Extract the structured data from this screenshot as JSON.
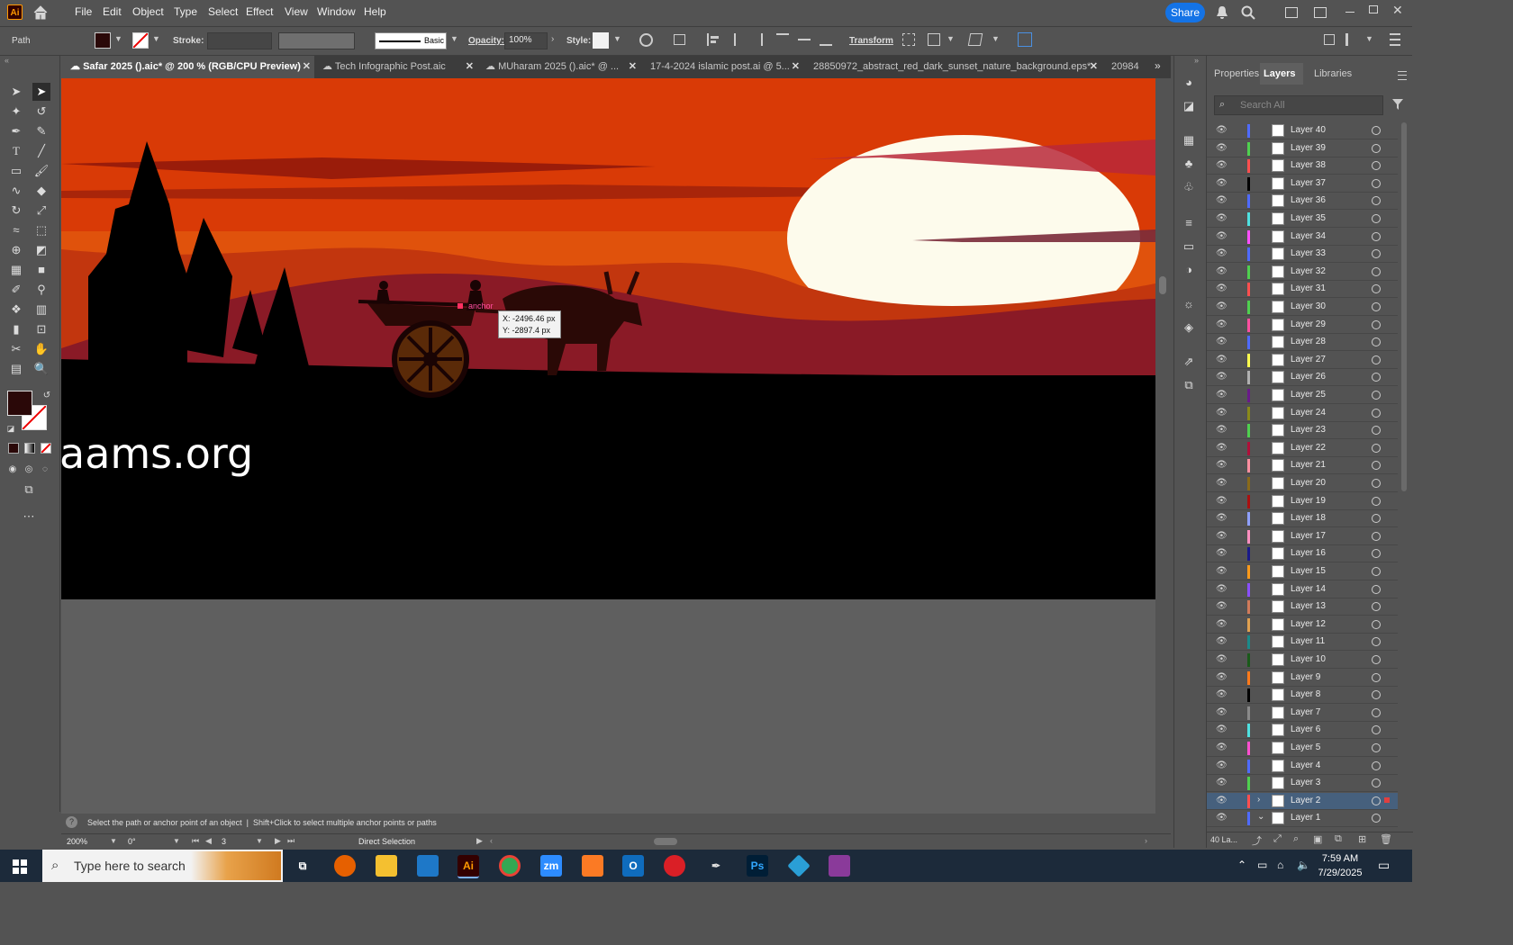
{
  "app": {
    "logo": "Ai",
    "home_icon": "home-icon"
  },
  "menu": [
    "File",
    "Edit",
    "Object",
    "Type",
    "Select",
    "Effect",
    "View",
    "Window",
    "Help"
  ],
  "header_right": {
    "share_label": "Share"
  },
  "control_bar": {
    "selection_type": "Path",
    "stroke_label": "Stroke:",
    "brush_label": "Basic",
    "opacity_label": "Opacity:",
    "opacity_value": "100%",
    "style_label": "Style:",
    "transform_label": "Transform"
  },
  "tabs": [
    {
      "label": "Safar 2025 ().aic* @ 200 % (RGB/CPU Preview)",
      "active": true
    },
    {
      "label": "Tech Infographic Post.aic"
    },
    {
      "label": "MUharam 2025 ().aic* @ ..."
    },
    {
      "label": "17-4-2024 islamic post.ai @ 5..."
    },
    {
      "label": "28850972_abstract_red_dark_sunset_nature_background.eps*"
    },
    {
      "label": "20984"
    }
  ],
  "artboard": {
    "text": "aams.org",
    "anchor_label": "anchor",
    "tooltip_x": "X: -2496.46 px",
    "tooltip_y": "Y: -2897.4 px",
    "colors": {
      "sky": "#d93a06",
      "sun": "#fdfbec",
      "hills": "#8a1a26",
      "ground": "#000000"
    }
  },
  "panel": {
    "tabs": [
      "Properties",
      "Layers",
      "Libraries"
    ],
    "active_tab": "Layers",
    "search_placeholder": "Search All",
    "layers": [
      {
        "name": "Layer 40",
        "color": "#4f6bff"
      },
      {
        "name": "Layer 39",
        "color": "#4fd04f"
      },
      {
        "name": "Layer 38",
        "color": "#ff4f4f"
      },
      {
        "name": "Layer 37",
        "color": "#000000"
      },
      {
        "name": "Layer 36",
        "color": "#4f6bff"
      },
      {
        "name": "Layer 35",
        "color": "#4fe0e0"
      },
      {
        "name": "Layer 34",
        "color": "#ff4fff"
      },
      {
        "name": "Layer 33",
        "color": "#4f6bff"
      },
      {
        "name": "Layer 32",
        "color": "#4fd04f"
      },
      {
        "name": "Layer 31",
        "color": "#ff4f4f"
      },
      {
        "name": "Layer 30",
        "color": "#4fd04f"
      },
      {
        "name": "Layer 29",
        "color": "#ff4fa0"
      },
      {
        "name": "Layer 28",
        "color": "#4f6bff"
      },
      {
        "name": "Layer 27",
        "color": "#ffff4f"
      },
      {
        "name": "Layer 26",
        "color": "#b0b0b0"
      },
      {
        "name": "Layer 25",
        "color": "#6a1a8a"
      },
      {
        "name": "Layer 24",
        "color": "#8a8a1a"
      },
      {
        "name": "Layer 23",
        "color": "#4fd04f"
      },
      {
        "name": "Layer 22",
        "color": "#b0103a"
      },
      {
        "name": "Layer 21",
        "color": "#ff8fa0"
      },
      {
        "name": "Layer 20",
        "color": "#8a6a1a"
      },
      {
        "name": "Layer 19",
        "color": "#aa1010"
      },
      {
        "name": "Layer 18",
        "color": "#8fa0ff"
      },
      {
        "name": "Layer 17",
        "color": "#ff8fc0"
      },
      {
        "name": "Layer 16",
        "color": "#1a1a8a"
      },
      {
        "name": "Layer 15",
        "color": "#ff9a1a"
      },
      {
        "name": "Layer 14",
        "color": "#8a4fff"
      },
      {
        "name": "Layer 13",
        "color": "#d07a5a"
      },
      {
        "name": "Layer 12",
        "color": "#e0a050"
      },
      {
        "name": "Layer 11",
        "color": "#1a8a8a"
      },
      {
        "name": "Layer 10",
        "color": "#1a5a1a"
      },
      {
        "name": "Layer 9",
        "color": "#ff7a1a"
      },
      {
        "name": "Layer 8",
        "color": "#000000"
      },
      {
        "name": "Layer 7",
        "color": "#8a8a8a"
      },
      {
        "name": "Layer 6",
        "color": "#4fe0e0"
      },
      {
        "name": "Layer 5",
        "color": "#ff4fd0"
      },
      {
        "name": "Layer 4",
        "color": "#4f6bff"
      },
      {
        "name": "Layer 3",
        "color": "#4fd04f"
      },
      {
        "name": "Layer 2",
        "color": "#ff4f4f",
        "selected": true,
        "expandable": true
      },
      {
        "name": "Layer 1",
        "color": "#4f6bff",
        "expanded": true
      }
    ],
    "footer_count": "40 La..."
  },
  "status": {
    "hint": "Select the path or anchor point of an object  |  Shift+Click to select multiple anchor points or paths",
    "zoom": "200%",
    "rotation": "0°",
    "artboard_num": "3",
    "tool_name": "Direct Selection"
  },
  "taskbar": {
    "search_placeholder": "Type here to search",
    "time": "7:59 AM",
    "date": "7/29/2025",
    "icons": [
      "firefox-icon",
      "file-explorer-icon",
      "vscode-icon",
      "illustrator-icon",
      "chrome-icon",
      "zoom-icon",
      "xampp-icon",
      "outlook-icon",
      "creative-cloud-icon",
      "pen-icon",
      "photoshop-icon",
      "app-icon",
      "winrar-icon"
    ]
  }
}
